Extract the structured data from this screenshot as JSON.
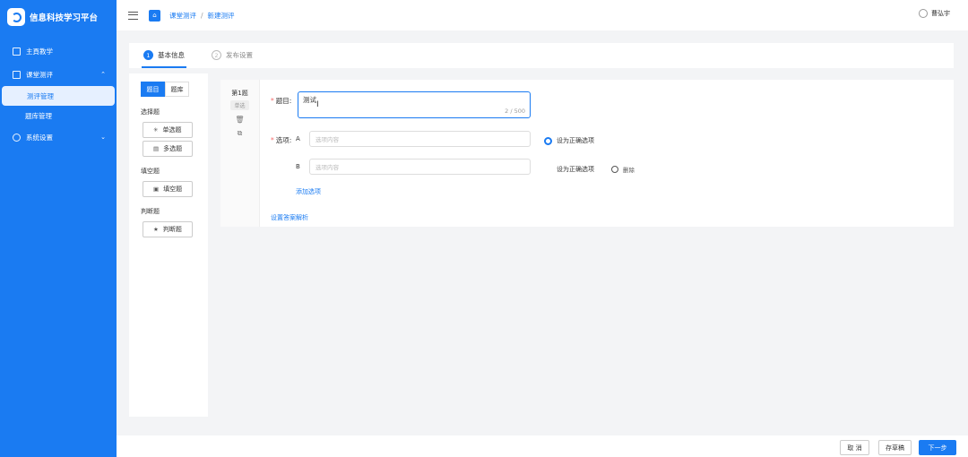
{
  "app": {
    "name": "信息科技学习平台"
  },
  "sidebar": {
    "items": [
      {
        "label": "主頁教学",
        "icon": "book-icon"
      },
      {
        "label": "课堂测评",
        "icon": "calendar-icon",
        "expanded": true,
        "children": [
          {
            "label": "测评管理",
            "active": true
          },
          {
            "label": "题库管理"
          }
        ]
      },
      {
        "label": "系统设置",
        "icon": "gear-icon"
      }
    ]
  },
  "topbar": {
    "breadcrumb": [
      "课堂测评",
      "新建测评"
    ],
    "user": "曹弘宇"
  },
  "steps": [
    {
      "num": "1",
      "label": "基本信息",
      "state": "active"
    },
    {
      "num": "2",
      "label": "发布设置",
      "state": "pending"
    }
  ],
  "question_types": {
    "tabs": [
      "题目",
      "题库"
    ],
    "groups": [
      {
        "title": "选择题",
        "buttons": [
          {
            "icon": "✳",
            "label": "单选题"
          },
          {
            "icon": "▤",
            "label": "多选题"
          }
        ]
      },
      {
        "title": "填空题",
        "buttons": [
          {
            "icon": "▣",
            "label": "填空题"
          }
        ]
      },
      {
        "title": "判断题",
        "buttons": [
          {
            "icon": "★",
            "label": "判断题"
          }
        ]
      }
    ]
  },
  "editor": {
    "question_no": "第1题",
    "question_type": "单选",
    "title_label": "题目:",
    "title_value": "测试",
    "title_count": "2 / 500",
    "options_label": "选项:",
    "options": [
      {
        "letter": "A",
        "placeholder": "选项内容",
        "correct_label": "设为正确选项",
        "correct": true
      },
      {
        "letter": "B",
        "placeholder": "选项内容",
        "correct_label": "设为正确选项",
        "correct": false
      }
    ],
    "delete_label": "删除",
    "add_option": "添加选项",
    "set_analysis": "设置答案解析"
  },
  "footer": {
    "cancel": "取 消",
    "save_draft": "存草稿",
    "next": "下一步"
  },
  "colors": {
    "primary": "#1a7bf2"
  }
}
